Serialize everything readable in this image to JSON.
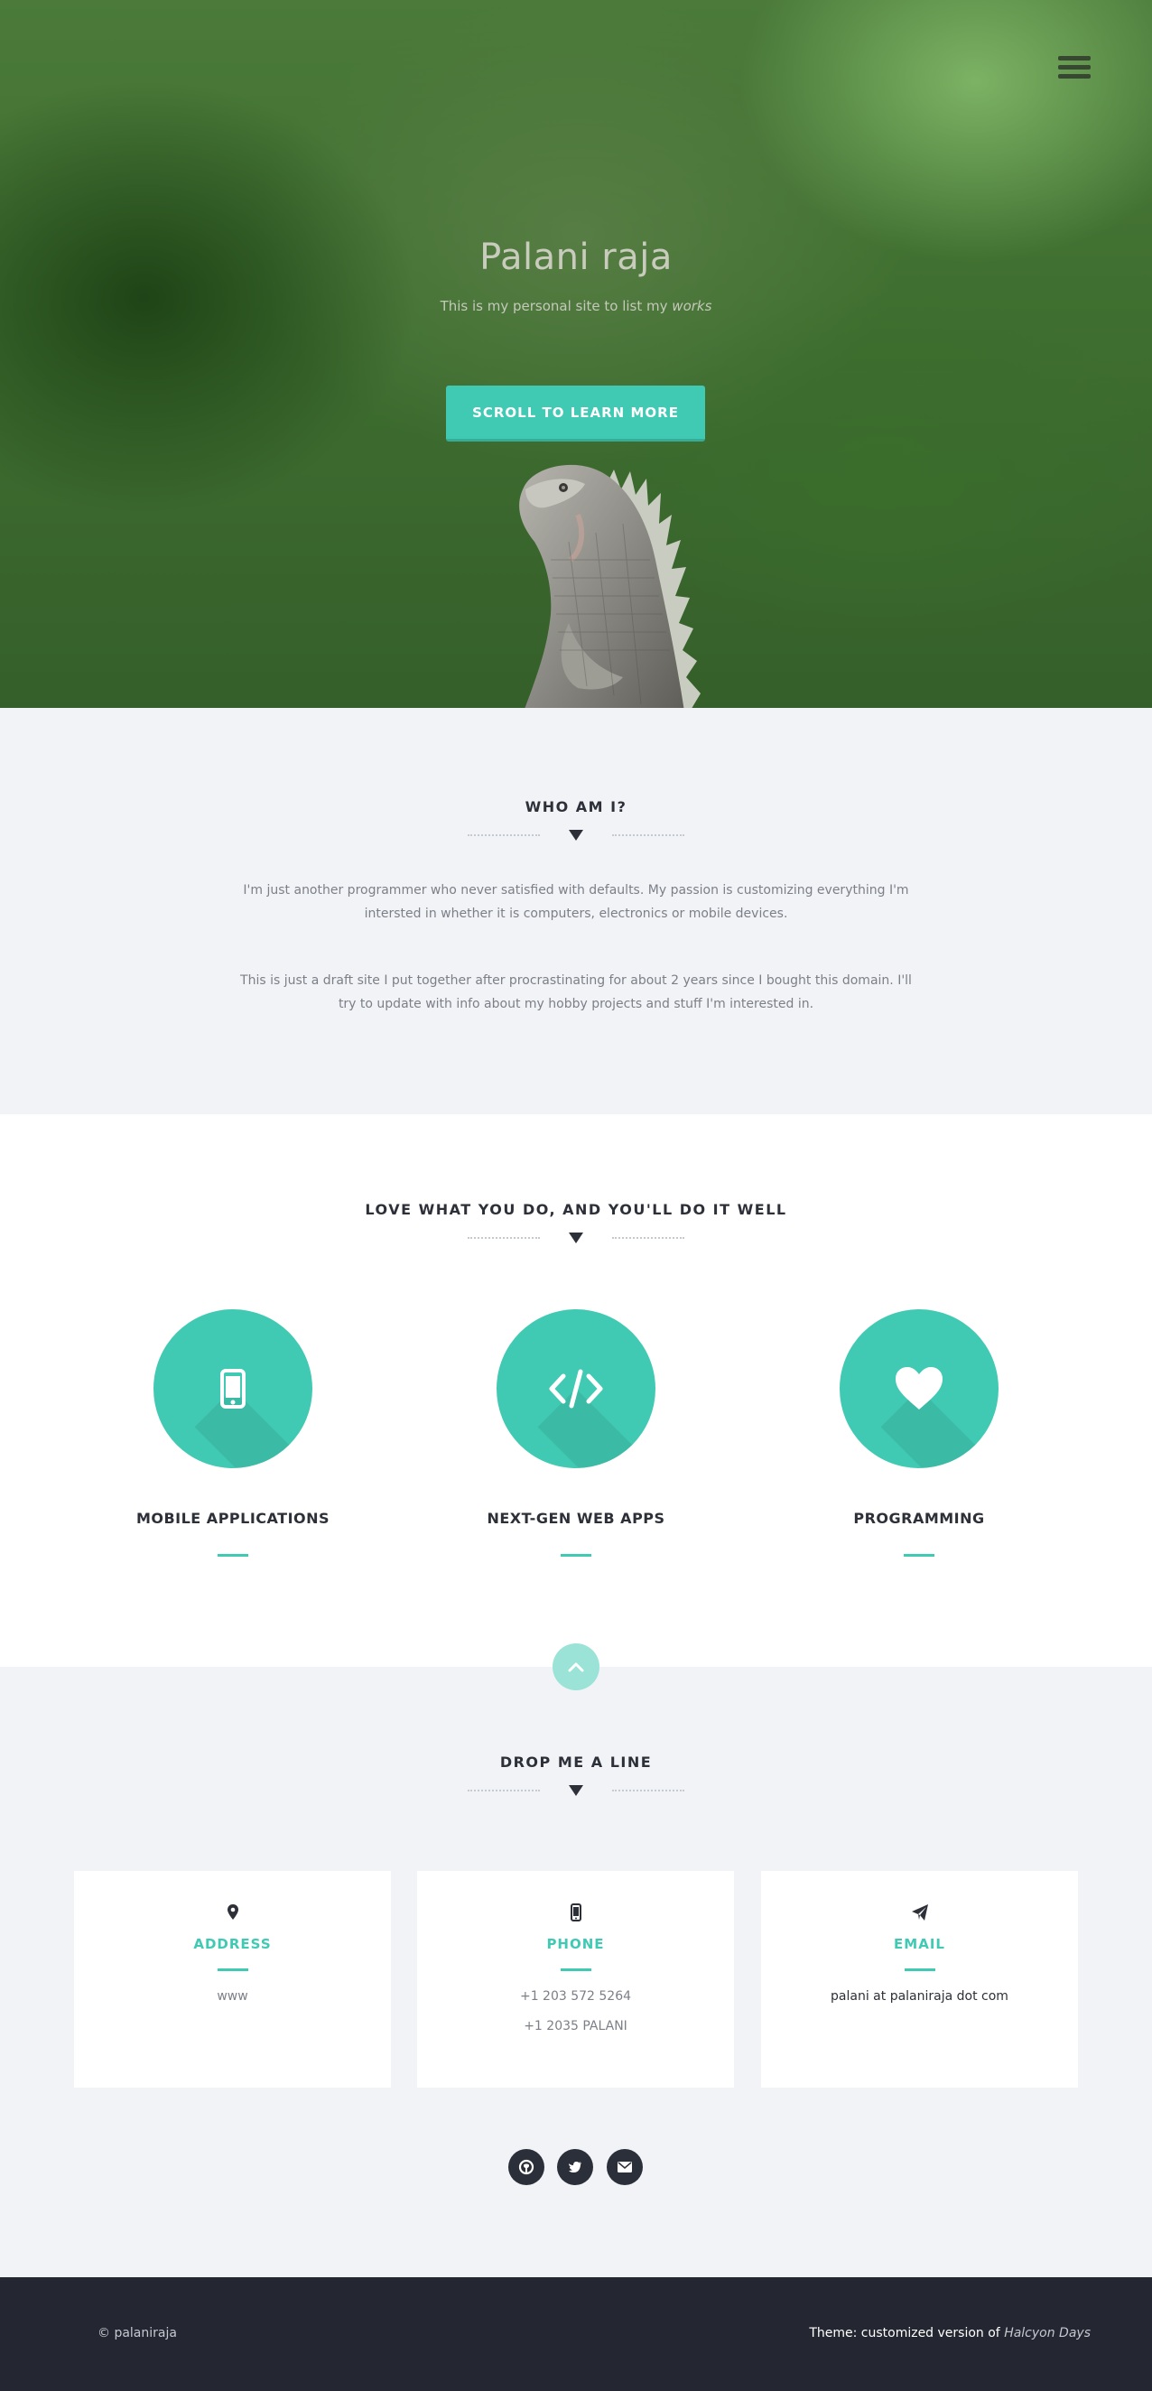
{
  "hero": {
    "title": "Palani raja",
    "subtitle": "This is my personal site to list my",
    "subtitle_emphasis": "works",
    "cta_label": "SCROLL TO LEARN MORE"
  },
  "about": {
    "title": "WHO AM I?",
    "paragraphs": [
      "I'm just another programmer who never satisfied with defaults. My passion is customizing everything I'm intersted in whether it is computers, electronics or mobile devices.",
      "This is just a draft site I put together after procrastinating for about 2 years since I bought this domain. I'll try to update with info about my hobby projects and stuff I'm interested in."
    ]
  },
  "services": {
    "title": "LOVE WHAT YOU DO, AND YOU'LL DO IT WELL",
    "items": [
      {
        "label": "MOBILE APPLICATIONS",
        "icon": "mobile-icon"
      },
      {
        "label": "NEXT-GEN WEB APPS",
        "icon": "code-icon"
      },
      {
        "label": "PROGRAMMING",
        "icon": "heart-icon"
      }
    ]
  },
  "contact": {
    "title": "DROP ME A LINE",
    "cards": [
      {
        "title": "ADDRESS",
        "icon": "map-marker-icon",
        "lines": [
          "www"
        ]
      },
      {
        "title": "PHONE",
        "icon": "mobile-icon",
        "lines": [
          "+1 203 572 5264",
          "+1 2035 PALANI"
        ]
      },
      {
        "title": "EMAIL",
        "icon": "paper-plane-icon",
        "lines": [
          "palani at palaniraja dot com"
        ]
      }
    ],
    "socials": [
      "github-icon",
      "twitter-icon",
      "envelope-icon"
    ]
  },
  "footer": {
    "copyright": "© palaniraja",
    "theme_prefix": "Theme: customized version of",
    "theme_name": "Halcyon Days"
  },
  "colors": {
    "accent": "#40c9b3",
    "dark": "#2d3039",
    "footer_bg": "#242731",
    "section_bg": "#f2f3f7"
  }
}
